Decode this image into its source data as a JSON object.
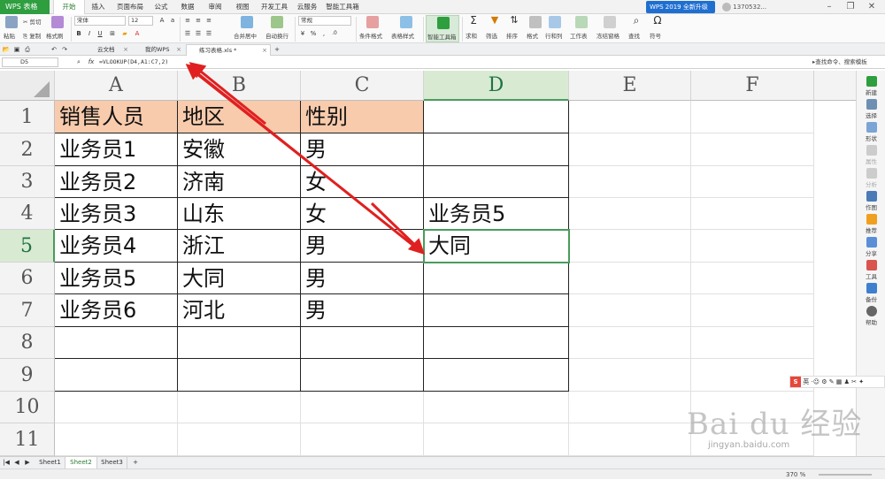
{
  "app": {
    "badge": "WPS 表格",
    "menu_tabs": [
      "开始",
      "插入",
      "页面布局",
      "公式",
      "数据",
      "审阅",
      "视图",
      "开发工具",
      "云服务",
      "智能工具箱"
    ],
    "active_menu": "开始",
    "promo": "WPS 2019 全新升级",
    "user": "1370532..."
  },
  "ribbon": {
    "paste": "粘贴",
    "cut": "剪切",
    "copy": "复制",
    "format_painter": "格式刷",
    "font_name": "宋体",
    "font_size": "12",
    "merge_center": "合并居中",
    "wrap_text": "自动换行",
    "number_format": "常规",
    "conditional_format": "条件格式",
    "table_style": "表格样式",
    "smart_toolbox": "智能工具箱",
    "sum": "求和",
    "filter": "筛选",
    "sort": "排序",
    "format": "格式",
    "row_col": "行和列",
    "worksheet": "工作表",
    "freeze": "冻结窗格",
    "find": "查找",
    "symbol": "符号"
  },
  "doc_tabs": [
    {
      "label": "云文档"
    },
    {
      "label": "我的WPS"
    },
    {
      "label": "练习表格.xls *"
    }
  ],
  "formula_bar": {
    "name_box": "D5",
    "fx": "fx",
    "formula": "=VLOOKUP(D4,A1:C7,2)",
    "search": "查找命令、搜索模板"
  },
  "grid": {
    "columns": [
      "A",
      "B",
      "C",
      "D",
      "E",
      "F"
    ],
    "rows": [
      "1",
      "2",
      "3",
      "4",
      "5",
      "6",
      "7",
      "8",
      "9",
      "10",
      "11"
    ],
    "cells": {
      "A1": "销售人员",
      "B1": "地区",
      "C1": "性别",
      "A2": "业务员1",
      "B2": "安徽",
      "C2": "男",
      "A3": "业务员2",
      "B3": "济南",
      "C3": "女",
      "A4": "业务员3",
      "B4": "山东",
      "C4": "女",
      "D4": "业务员5",
      "A5": "业务员4",
      "B5": "浙江",
      "C5": "男",
      "D5": "大同",
      "A6": "业务员5",
      "B6": "大同",
      "C6": "男",
      "A7": "业务员6",
      "B7": "河北",
      "C7": "男"
    },
    "active_cell": "D5",
    "header_fill": "#f8cbad"
  },
  "right_sidebar": [
    "新建",
    "选择",
    "形状",
    "属性",
    "分析",
    "作图",
    "推荐",
    "分享",
    "工具",
    "备份",
    "帮助"
  ],
  "sheets": [
    "Sheet1",
    "Sheet2",
    "Sheet3"
  ],
  "active_sheet": "Sheet2",
  "status": {
    "zoom": "370 %"
  },
  "overlay": {
    "ime": "英",
    "watermark": "Bai du 经验",
    "watermark_url": "jingyan.baidu.com"
  }
}
